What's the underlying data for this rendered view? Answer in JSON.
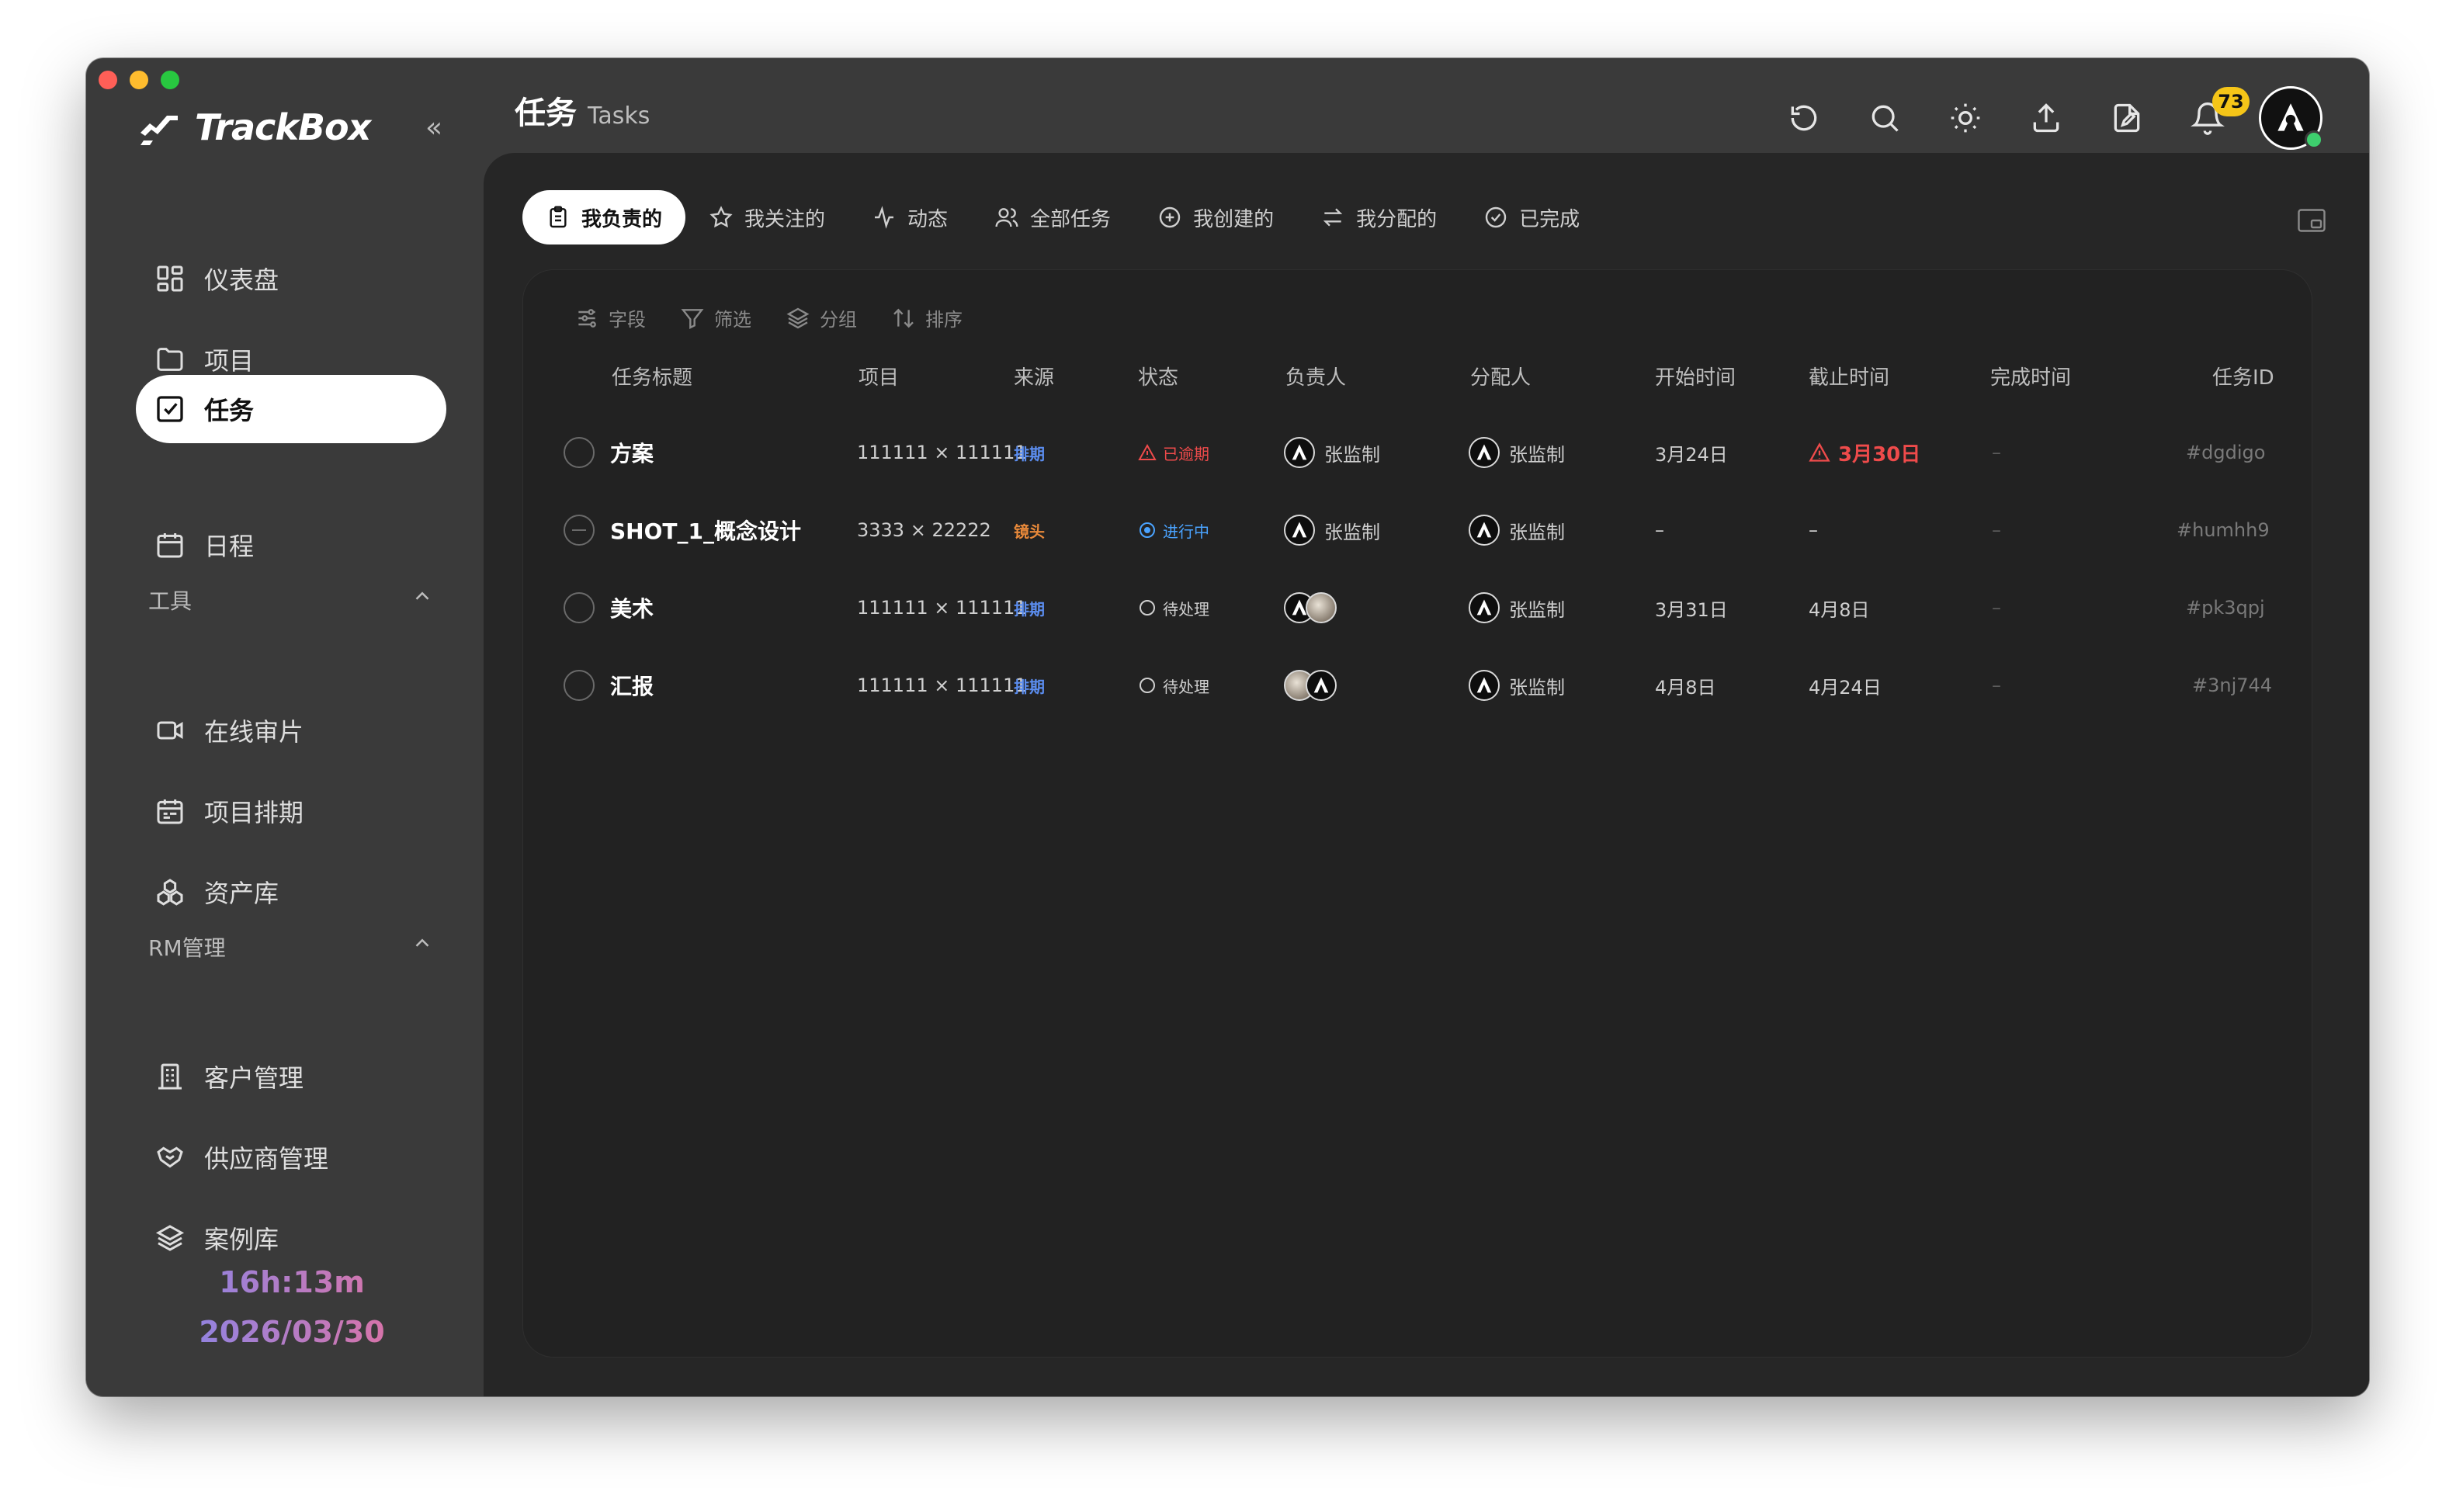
{
  "app": {
    "name": "TrackBox",
    "page_title_zh": "任务",
    "page_title_en": "Tasks",
    "notification_count": "73"
  },
  "sidebar": {
    "items": [
      {
        "label": "仪表盘",
        "icon": "dashboard-icon"
      },
      {
        "label": "项目",
        "icon": "folder-icon"
      },
      {
        "label": "任务",
        "icon": "task-check-icon",
        "active": true
      },
      {
        "label": "日程",
        "icon": "calendar-icon"
      }
    ],
    "tools_label": "工具",
    "tools": [
      {
        "label": "在线审片",
        "icon": "video-icon"
      },
      {
        "label": "项目排期",
        "icon": "schedule-icon"
      },
      {
        "label": "资产库",
        "icon": "assets-icon"
      }
    ],
    "rm_label": "RM管理",
    "rm": [
      {
        "label": "客户管理",
        "icon": "building-icon"
      },
      {
        "label": "供应商管理",
        "icon": "handshake-icon"
      },
      {
        "label": "案例库",
        "icon": "layers-icon"
      }
    ],
    "timer": "16h:13m",
    "date": "2026/03/30"
  },
  "tabs": [
    {
      "label": "我负责的",
      "icon": "clipboard-icon",
      "active": true
    },
    {
      "label": "我关注的",
      "icon": "star-icon"
    },
    {
      "label": "动态",
      "icon": "activity-icon"
    },
    {
      "label": "全部任务",
      "icon": "users-icon"
    },
    {
      "label": "我创建的",
      "icon": "plus-circle-icon"
    },
    {
      "label": "我分配的",
      "icon": "swap-icon"
    },
    {
      "label": "已完成",
      "icon": "check-circle-icon"
    }
  ],
  "toolbar": {
    "fields": "字段",
    "filter": "筛选",
    "group": "分组",
    "sort": "排序"
  },
  "columns": {
    "title": "任务标题",
    "project": "项目",
    "source": "来源",
    "status": "状态",
    "owner": "负责人",
    "assigner": "分配人",
    "start": "开始时间",
    "due": "截止时间",
    "done": "完成时间",
    "id": "任务ID"
  },
  "rows": [
    {
      "title": "方案",
      "project": "111111 × 111111",
      "source": "排期",
      "source_color": "#5b8def",
      "status": "已逾期",
      "status_color": "#ef4b4b",
      "status_icon": "warning-icon",
      "owner": "张监制",
      "assigner": "张监制",
      "start": "3月24日",
      "due": "3月30日",
      "due_overdue": true,
      "done": "–",
      "id": "#dgdigo"
    },
    {
      "title": "SHOT_1_概念设计",
      "project": "3333 × 22222",
      "source": "镜头",
      "source_color": "#e8893a",
      "status": "进行中",
      "status_color": "#4aa3ff",
      "status_icon": "in-progress-icon",
      "owner": "张监制",
      "assigner": "张监制",
      "start": "–",
      "due": "–",
      "due_overdue": false,
      "done": "–",
      "id": "#humhh9"
    },
    {
      "title": "美术",
      "project": "111111 × 111111",
      "source": "排期",
      "source_color": "#5b8def",
      "status": "待处理",
      "status_color": "#cfcfcf",
      "status_icon": "pending-icon",
      "owner": "",
      "assigner": "张监制",
      "start": "3月31日",
      "due": "4月8日",
      "due_overdue": false,
      "done": "–",
      "id": "#pk3qpj"
    },
    {
      "title": "汇报",
      "project": "111111 × 111111",
      "source": "排期",
      "source_color": "#5b8def",
      "status": "待处理",
      "status_color": "#cfcfcf",
      "status_icon": "pending-icon",
      "owner": "",
      "assigner": "张监制",
      "start": "4月8日",
      "due": "4月24日",
      "due_overdue": false,
      "done": "–",
      "id": "#3nj744"
    }
  ]
}
